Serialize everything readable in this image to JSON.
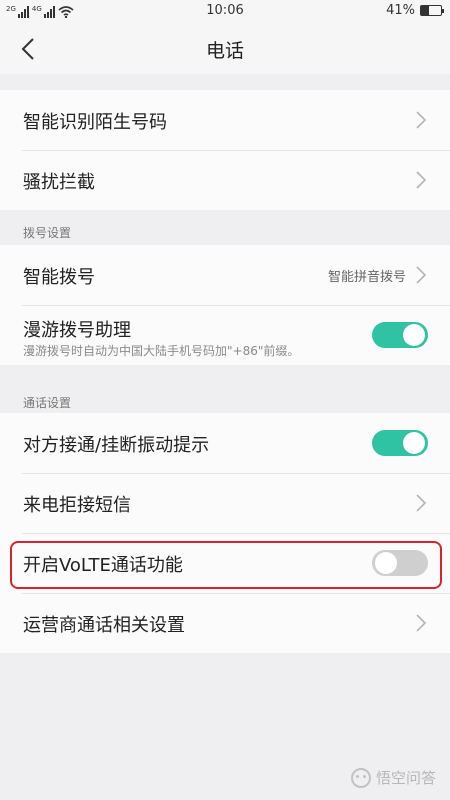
{
  "status_bar": {
    "sim1_label": "2G",
    "sim2_label": "4G",
    "time": "10:06",
    "battery_percent": "41%",
    "battery_level": 0.41
  },
  "nav": {
    "title": "电话",
    "back_icon": "chevron-left-icon"
  },
  "group1": {
    "items": [
      {
        "label": "智能识别陌生号码",
        "type": "link"
      },
      {
        "label": "骚扰拦截",
        "type": "link"
      }
    ]
  },
  "section_dial": {
    "header": "拨号设置",
    "items": [
      {
        "label": "智能拨号",
        "type": "link",
        "value": "智能拼音拨号"
      },
      {
        "label": "漫游拨号助理",
        "sublabel": "漫游拨号时自动为中国大陆手机号码加\"+86\"前缀。",
        "type": "toggle",
        "state": "on"
      }
    ]
  },
  "section_call": {
    "header": "通话设置",
    "items": [
      {
        "label": "对方接通/挂断振动提示",
        "type": "toggle",
        "state": "on"
      },
      {
        "label": "来电拒接短信",
        "type": "link"
      },
      {
        "label": "开启VoLTE通话功能",
        "type": "toggle",
        "state": "off"
      },
      {
        "label": "运营商通话相关设置",
        "type": "link"
      }
    ]
  },
  "colors": {
    "toggle_on": "#2fc3a4",
    "toggle_off": "#cfcfcf",
    "highlight": "#d8232f",
    "background": "#efeff1"
  },
  "watermark": {
    "text": "悟空问答",
    "icon": "wukong-logo-icon"
  }
}
